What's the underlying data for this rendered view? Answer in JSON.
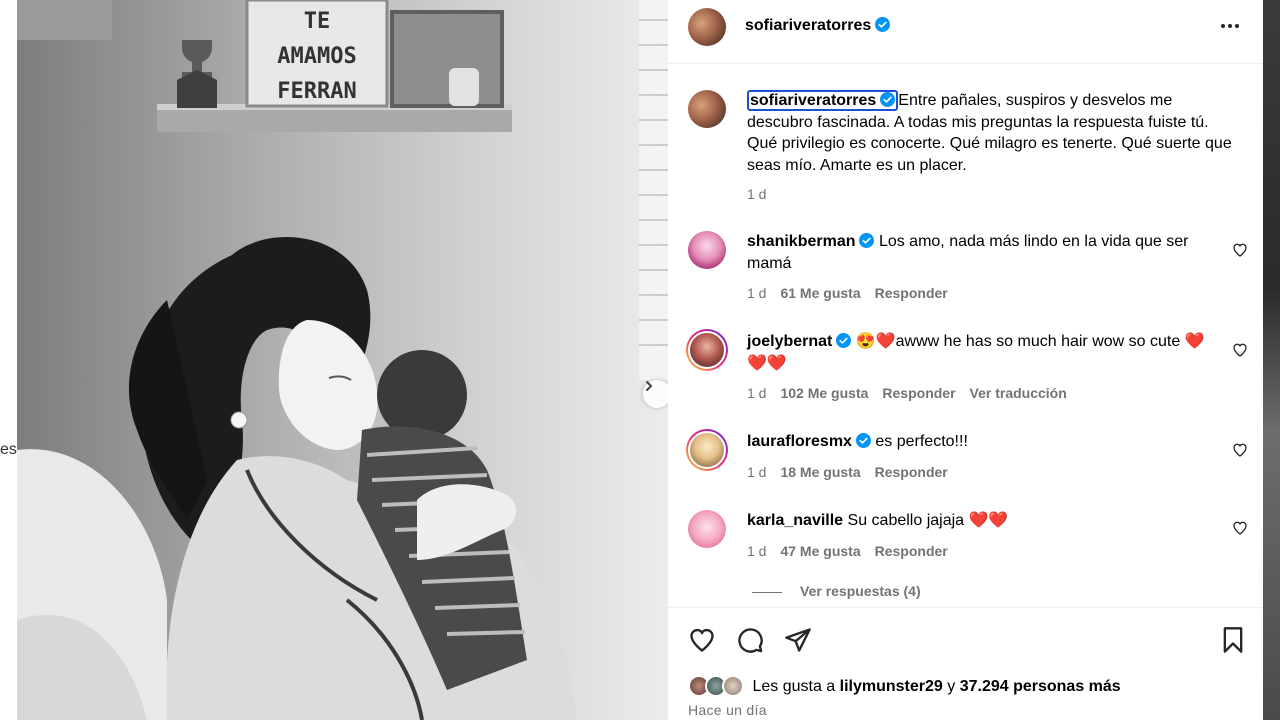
{
  "background": {
    "left_fragment": "es"
  },
  "post": {
    "author": "sofiariveratorres",
    "verified": true,
    "caption_user": "sofiariveratorres",
    "caption_text": "Entre pañales, suspiros y desvelos me descubro fascinada. A todas mis preguntas la respuesta fuiste tú. Qué privilegio es conocerte. Qué milagro es tenerte. Qué suerte que seas mío. Amarte es un placer.",
    "caption_time": "1 d",
    "photo": {
      "shelf_sign_lines": [
        "TE",
        "AMAMOS",
        "FERRAN"
      ],
      "description_icon": "photo-mother-baby"
    }
  },
  "comments": [
    {
      "user": "shanikberman",
      "verified": true,
      "text": "Los amo, nada más lindo en la vida que ser mamá",
      "time": "1 d",
      "likes": "61 Me gusta",
      "reply": "Responder",
      "translate": ""
    },
    {
      "user": "joelybernat",
      "verified": true,
      "text": "😍❤️awww he has so much hair wow so cute ❤️❤️❤️",
      "time": "1 d",
      "likes": "102 Me gusta",
      "reply": "Responder",
      "translate": "Ver traducción"
    },
    {
      "user": "laurafloresmx",
      "verified": true,
      "text": "es perfecto!!!",
      "time": "1 d",
      "likes": "18 Me gusta",
      "reply": "Responder",
      "translate": ""
    },
    {
      "user": "karla_naville",
      "verified": false,
      "text": "Su cabello jajaja ❤️❤️",
      "time": "1 d",
      "likes": "47 Me gusta",
      "reply": "Responder",
      "translate": ""
    }
  ],
  "view_replies": "Ver respuestas (4)",
  "likes_line": {
    "prefix": "Les gusta a",
    "first_user": "lilymunster29",
    "conjunction": "y",
    "others": "37.294 personas más"
  },
  "time_ago": "Hace un día",
  "colors": {
    "verified_blue": "#0095f6",
    "meta_gray": "#737373",
    "focus_outline": "#1d4fd6"
  },
  "icons": {
    "more": "more-options-icon",
    "like": "heart-icon",
    "comment": "comment-icon",
    "share": "send-icon",
    "save": "bookmark-icon",
    "next": "chevron-right-icon"
  }
}
